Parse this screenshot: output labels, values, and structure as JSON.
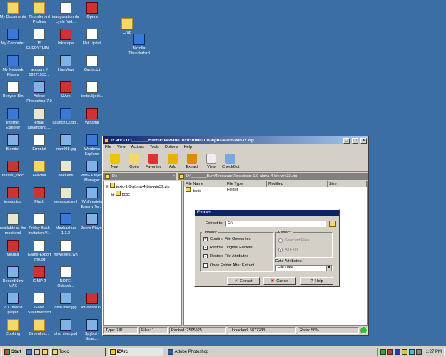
{
  "desktop": {
    "icons": [
      "My Documents",
      "Thunderbird Profiles",
      "inauguration du cycle 'Vid...",
      "Opera",
      "My Computer",
      "15 EVERYTHIN...",
      "Inkscape",
      "Put Up.txt",
      "My Network Places",
      "account # 59271533...",
      "IrfanView",
      "Quote.txt",
      "Recycle Bin",
      "Adobe Photoshop 7.0",
      "IZArc",
      "textsubject...",
      "Internet Explorer",
      "email advertising....",
      "Launch Outlo...",
      "Winamp",
      "Blender",
      "Error.txt",
      "man098.jpg",
      "Windows Explorer",
      "tessss_toxic",
      "FileZilla",
      "neet.eml",
      "WME Project Manager",
      "tessss.tga",
      "Flash",
      "message.eml",
      "Wolfenstein Enemy Ter...",
      "available at the most.eml",
      "Friday Bash invitation.V...",
      "Mozbackup 1.3.2",
      "Zoom Player",
      "Mozilla",
      "Game-Export Info.txt",
      "newestest.wn",
      "",
      "RecordNow MAX",
      "GIMP 2",
      "NOTE! Osbank...",
      "",
      "VLC media player",
      "Good Statement.txt",
      "ohio river.jpg",
      "Ad-aware 6...",
      "Cooking",
      "GreenInfo...",
      "ohio river.psd",
      "Spybot - Searc..."
    ],
    "extra": [
      "Crap",
      "Mozilla Thunderbird"
    ]
  },
  "izarc": {
    "title": "IZArc - D:\\_______Burn\\Freeware\\Toxic\\toxic-1.0-alpha-4-bin-win32.zip",
    "menu": [
      "File",
      "View",
      "Actions",
      "Tools",
      "Options",
      "Help"
    ],
    "toolbar": [
      "New",
      "Open",
      "Favorites",
      "Add",
      "Extract",
      "View",
      "CheckOut"
    ],
    "left_path": "D:\\",
    "right_path": "D:\\_______Burn\\Freeware\\Toxic\\toxic-1.0-alpha-4-bin-win32.zip",
    "tree_root": "toxic-1.0-alpha-4-bin-win32.zip",
    "tree_child": "toxic",
    "columns": [
      "File Name",
      "File Type",
      "Modified",
      "Size"
    ],
    "rows": [
      {
        "name": "toxic",
        "type": "Folder",
        "modified": "",
        "size": ""
      }
    ],
    "status": {
      "type": "Type: ZIP",
      "files": "Files: 1",
      "packed": "Packed: 2565925",
      "unpacked": "Unpacked: 5877288",
      "ratio": "Ratio: 56%"
    }
  },
  "extract_dialog": {
    "title": "Extract",
    "extract_to_label": "Extract to:",
    "extract_to_value": "C:\\",
    "options_label": "Options:",
    "options": [
      {
        "label": "Confirm File Overwrites",
        "checked": true
      },
      {
        "label": "Restore Original Folders",
        "checked": true
      },
      {
        "label": "Restore File Attributes",
        "checked": true
      },
      {
        "label": "Open Folder After Extract",
        "checked": false
      }
    ],
    "extract_label": "Extract:",
    "selected_files": "Selected Files",
    "all_files": "All Files",
    "date_attr_label": "Date Attributes:",
    "date_attr_value": "File Date",
    "buttons": {
      "extract": "Extract",
      "cancel": "Cancel",
      "help": "Help"
    }
  },
  "taskbar": {
    "start": "Start",
    "tasks": [
      "Toxic",
      "IZArc",
      "Adobe Photoshop"
    ],
    "clock": "1:27 PM"
  }
}
